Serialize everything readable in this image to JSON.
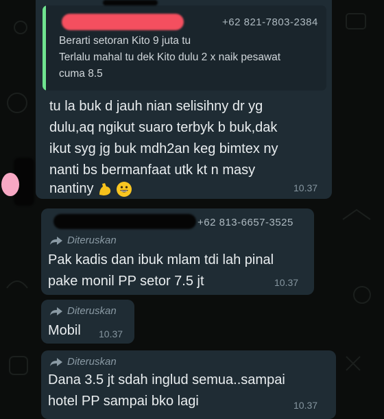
{
  "messages": [
    {
      "quoted": {
        "phone": "+62 821-7803-2384",
        "lines": [
          "Berarti setoran Kito 9 juta tu",
          "Terlalu mahal tu dek Kito dulu 2 x naik pesawat",
          "cuma 8.5"
        ]
      },
      "lines": [
        "tu la  buk d jauh nian selisihny dr yg",
        "dulu,aq ngikut suaro terbyk b buk,dak",
        "ikut syg jg buk mdh2an keg bimtex ny",
        "nanti bs bermanfaat utk kt n masy",
        "nantiny"
      ],
      "time": "10.37"
    },
    {
      "phone": "+62 813-6657-3525",
      "forwarded": "Diteruskan",
      "lines": [
        "Pak kadis dan ibuk mlam tdi lah pinal",
        "pake monil PP setor 7.5 jt"
      ],
      "time": "10.37"
    },
    {
      "forwarded": "Diteruskan",
      "lines": [
        "Mobil"
      ],
      "time": "10.37"
    },
    {
      "forwarded": "Diteruskan",
      "lines": [
        "Dana 3.5 jt sdah inglud semua..sampai",
        "hotel PP sampai bko lagi"
      ],
      "time": "10.37"
    }
  ],
  "emojis": [
    "flexed-biceps-icon",
    "grinning-face-icon"
  ],
  "colors": {
    "background": "#0b0d0c",
    "bubble": "#1f2c34",
    "quote_bar": "#6fe38f",
    "text": "#e9edef",
    "meta": "#8696a0"
  }
}
